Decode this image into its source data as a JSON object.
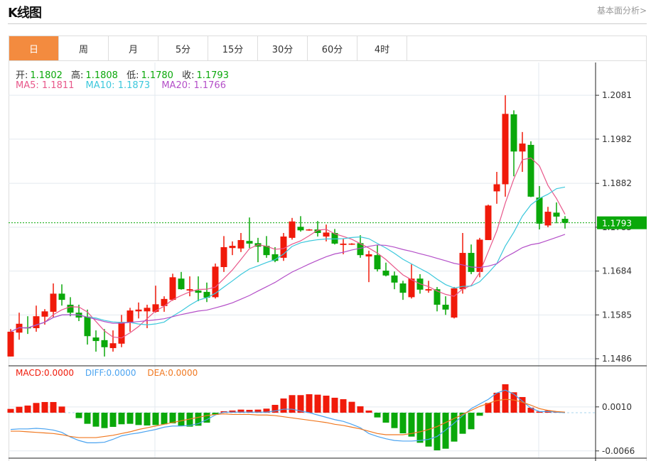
{
  "header": {
    "title": "K线图",
    "more_link": "基本面分析>"
  },
  "tabs": [
    {
      "label": "日",
      "active": true
    },
    {
      "label": "周",
      "active": false
    },
    {
      "label": "月",
      "active": false
    },
    {
      "label": "5分",
      "active": false
    },
    {
      "label": "15分",
      "active": false
    },
    {
      "label": "30分",
      "active": false
    },
    {
      "label": "60分",
      "active": false
    },
    {
      "label": "4时",
      "active": false
    }
  ],
  "ohlc_legend": {
    "open_label": "开:",
    "open": "1.1802",
    "high_label": "高:",
    "high": "1.1808",
    "low_label": "低:",
    "low": "1.1780",
    "close_label": "收:",
    "close": "1.1793"
  },
  "ma_legend": {
    "ma5": "MA5: 1.1811",
    "ma10": "MA10: 1.1873",
    "ma20": "MA20: 1.1766"
  },
  "macd_legend": {
    "macd": "MACD:0.0000",
    "diff": "DIFF:0.0000",
    "dea": "DEA:0.0000"
  },
  "colors": {
    "up": "#f01a0a",
    "down": "#0aa80a",
    "active_tab": "#f38b3f",
    "ma5": "#e8578a",
    "ma10": "#3cc8dc",
    "ma20": "#b44fc8",
    "diff": "#4aa3f0",
    "dea": "#f07820"
  },
  "chart_data": [
    {
      "type": "candlestick",
      "title": "",
      "ylim": [
        1.147,
        1.2155
      ],
      "y_ticks": [
        "1.2081",
        "1.1982",
        "1.1882",
        "1.1783",
        "1.1684",
        "1.1585",
        "1.1486"
      ],
      "last_price_label": "1.1793",
      "grid": true,
      "ohlc": [
        [
          1.1491,
          1.1553,
          1.1491,
          1.1547
        ],
        [
          1.1545,
          1.159,
          1.1529,
          1.1565
        ],
        [
          1.1557,
          1.1582,
          1.1542,
          1.1555
        ],
        [
          1.1555,
          1.1606,
          1.1547,
          1.1582
        ],
        [
          1.1581,
          1.1598,
          1.1563,
          1.1593
        ],
        [
          1.1592,
          1.1656,
          1.1579,
          1.1633
        ],
        [
          1.1633,
          1.1654,
          1.1606,
          1.1619
        ],
        [
          1.1608,
          1.1625,
          1.1582,
          1.159
        ],
        [
          1.159,
          1.1608,
          1.1571,
          1.1579
        ],
        [
          1.1581,
          1.1597,
          1.1518,
          1.1537
        ],
        [
          1.1534,
          1.155,
          1.1502,
          1.1526
        ],
        [
          1.1528,
          1.1553,
          1.1491,
          1.1512
        ],
        [
          1.151,
          1.155,
          1.1502,
          1.1521
        ],
        [
          1.152,
          1.1585,
          1.1512,
          1.1569
        ],
        [
          1.1568,
          1.1601,
          1.1547,
          1.1595
        ],
        [
          1.1593,
          1.1613,
          1.1577,
          1.1597
        ],
        [
          1.1593,
          1.1608,
          1.1555,
          1.1601
        ],
        [
          1.1592,
          1.1651,
          1.159,
          1.1609
        ],
        [
          1.1605,
          1.1627,
          1.1592,
          1.1621
        ],
        [
          1.1619,
          1.1678,
          1.1617,
          1.167
        ],
        [
          1.1667,
          1.1682,
          1.1642,
          1.1643
        ],
        [
          1.164,
          1.1672,
          1.1627,
          1.1643
        ],
        [
          1.164,
          1.1672,
          1.1616,
          1.1635
        ],
        [
          1.1637,
          1.1658,
          1.1614,
          1.1624
        ],
        [
          1.1625,
          1.1701,
          1.1622,
          1.1694
        ],
        [
          1.1693,
          1.1763,
          1.1682,
          1.1738
        ],
        [
          1.1736,
          1.1751,
          1.172,
          1.1741
        ],
        [
          1.1735,
          1.177,
          1.1727,
          1.1754
        ],
        [
          1.1752,
          1.1805,
          1.1736,
          1.1746
        ],
        [
          1.1747,
          1.1759,
          1.1704,
          1.1739
        ],
        [
          1.1741,
          1.1763,
          1.1714,
          1.172
        ],
        [
          1.1722,
          1.1738,
          1.1704,
          1.1707
        ],
        [
          1.1714,
          1.177,
          1.1707,
          1.1762
        ],
        [
          1.1759,
          1.1804,
          1.1755,
          1.1796
        ],
        [
          1.1784,
          1.1808,
          1.1773,
          1.1776
        ],
        [
          1.1776,
          1.1779,
          1.1775,
          1.1778
        ],
        [
          1.1778,
          1.1797,
          1.1762,
          1.177
        ],
        [
          1.1762,
          1.1789,
          1.1751,
          1.1771
        ],
        [
          1.177,
          1.1779,
          1.1744,
          1.1746
        ],
        [
          1.1743,
          1.1757,
          1.1722,
          1.1746
        ],
        [
          1.1744,
          1.1747,
          1.1743,
          1.1746
        ],
        [
          1.1747,
          1.1765,
          1.1714,
          1.172
        ],
        [
          1.1717,
          1.173,
          1.1659,
          1.1722
        ],
        [
          1.172,
          1.1743,
          1.1683,
          1.1688
        ],
        [
          1.1685,
          1.1703,
          1.1672,
          1.1674
        ],
        [
          1.1674,
          1.1683,
          1.1643,
          1.1658
        ],
        [
          1.1656,
          1.1662,
          1.1619,
          1.1635
        ],
        [
          1.1625,
          1.1699,
          1.1622,
          1.1667
        ],
        [
          1.1667,
          1.1677,
          1.1633,
          1.1642
        ],
        [
          1.164,
          1.1662,
          1.1635,
          1.1643
        ],
        [
          1.1643,
          1.1648,
          1.1593,
          1.1608
        ],
        [
          1.1608,
          1.1627,
          1.1585,
          1.1597
        ],
        [
          1.1579,
          1.1648,
          1.1577,
          1.1645
        ],
        [
          1.1643,
          1.177,
          1.1633,
          1.1725
        ],
        [
          1.1725,
          1.1744,
          1.1677,
          1.1682
        ],
        [
          1.1682,
          1.1759,
          1.167,
          1.1755
        ],
        [
          1.1754,
          1.1834,
          1.1754,
          1.1832
        ],
        [
          1.1864,
          1.1908,
          1.1836,
          1.188
        ],
        [
          1.188,
          1.2081,
          1.1852,
          1.2039
        ],
        [
          1.2038,
          1.2047,
          1.1898,
          1.1954
        ],
        [
          1.1954,
          1.1998,
          1.1908,
          1.1972
        ],
        [
          1.1969,
          1.1977,
          1.1851,
          1.1852
        ],
        [
          1.185,
          1.1876,
          1.1778,
          1.1791
        ],
        [
          1.1787,
          1.1829,
          1.1783,
          1.1818
        ],
        [
          1.1816,
          1.1839,
          1.1792,
          1.1807
        ],
        [
          1.1802,
          1.1808,
          1.178,
          1.1793
        ]
      ]
    },
    {
      "type": "bar",
      "title": "",
      "ylim": [
        -0.00785,
        0.00809
      ],
      "y_ticks": [
        "0.0010",
        "-0.0066"
      ],
      "macd": [
        0.00065,
        0.00102,
        0.00123,
        0.00168,
        0.00184,
        0.00184,
        0.00106,
        0,
        -0.00094,
        -0.00192,
        -0.00241,
        -0.00266,
        -0.00245,
        -0.002,
        -0.00192,
        -0.00213,
        -0.00221,
        -0.00213,
        -0.002,
        -0.00184,
        -0.00233,
        -0.00241,
        -0.00225,
        -0.00172,
        -0.00037,
        0.00025,
        0.00037,
        0.00053,
        0.00049,
        0.00053,
        0.0007,
        0.00135,
        0.00245,
        0.00303,
        0.00303,
        0.00319,
        0.00311,
        0.00294,
        0.00258,
        0.00233,
        0.00188,
        0.0011,
        0.00037,
        -0.00082,
        -0.00172,
        -0.00266,
        -0.00356,
        -0.00413,
        -0.00519,
        -0.00585,
        -0.0065,
        -0.00622,
        -0.00499,
        -0.00364,
        -0.00286,
        -0.00053,
        0.00168,
        0.00344,
        0.00491,
        0.00352,
        0.0027,
        0.00086,
        0.0002,
        0.00037,
        0.00012,
        0
      ],
      "diff": [
        -0.0029,
        -0.0028,
        -0.0028,
        -0.0027,
        -0.0028,
        -0.003,
        -0.0034,
        -0.0042,
        -0.0048,
        -0.0052,
        -0.0052,
        -0.0051,
        -0.0046,
        -0.004,
        -0.0037,
        -0.0035,
        -0.0032,
        -0.0029,
        -0.0025,
        -0.0023,
        -0.0023,
        -0.0022,
        -0.0019,
        -0.0012,
        -0.0004,
        0.0001,
        0.0001,
        0.0001,
        0.0001,
        0.0001,
        0.0001,
        0.0003,
        0.0006,
        0.0006,
        0.0003,
        0.0,
        -0.0004,
        -0.0008,
        -0.0012,
        -0.0015,
        -0.002,
        -0.0026,
        -0.0036,
        -0.0041,
        -0.0045,
        -0.0048,
        -0.0049,
        -0.0049,
        -0.0048,
        -0.0046,
        -0.0041,
        -0.003,
        -0.0018,
        -0.0005,
        0.0007,
        0.0015,
        0.0023,
        0.0034,
        0.0039,
        0.0032,
        0.002,
        0.0008,
        0.0002,
        0.0002,
        0.0001,
        0.0
      ],
      "dea": [
        -0.0032,
        -0.0032,
        -0.0033,
        -0.0034,
        -0.0035,
        -0.0036,
        -0.0038,
        -0.0041,
        -0.0043,
        -0.0043,
        -0.0043,
        -0.0041,
        -0.0039,
        -0.0036,
        -0.0033,
        -0.0029,
        -0.0026,
        -0.0023,
        -0.002,
        -0.0017,
        -0.0014,
        -0.0011,
        -0.0008,
        -0.0005,
        -0.0003,
        -0.0002,
        -0.0003,
        -0.0003,
        -0.0003,
        -0.0004,
        -0.0004,
        -0.0005,
        -0.0007,
        -0.0009,
        -0.0011,
        -0.0013,
        -0.0015,
        -0.0017,
        -0.002,
        -0.0022,
        -0.0025,
        -0.0028,
        -0.0032,
        -0.0036,
        -0.0038,
        -0.0038,
        -0.0038,
        -0.0036,
        -0.0033,
        -0.0029,
        -0.0024,
        -0.0017,
        -0.001,
        -0.0003,
        0.0004,
        0.0011,
        0.0016,
        0.0021,
        0.0023,
        0.0022,
        0.0018,
        0.0013,
        0.0007,
        0.0004,
        0.0002,
        0.0001
      ]
    }
  ]
}
